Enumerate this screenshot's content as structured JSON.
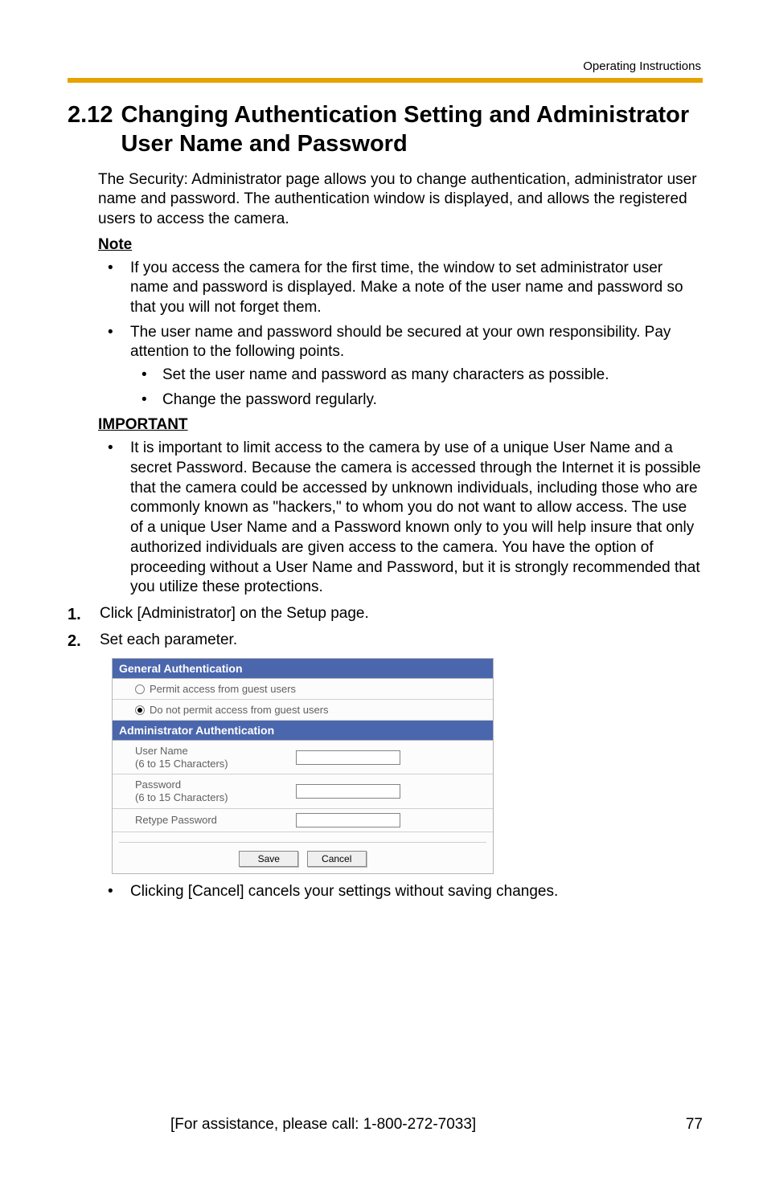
{
  "header": {
    "label": "Operating Instructions"
  },
  "section": {
    "number": "2.12",
    "title": "Changing Authentication Setting and Administrator User Name and Password"
  },
  "intro": "The Security: Administrator page allows you to change authentication, administrator user name and password. The authentication window is displayed, and allows the registered users to access the camera.",
  "note": {
    "heading": "Note",
    "items": [
      "If you access the camera for the first time, the window to set administrator user name and password is displayed. Make a note of the user name and password so that you will not forget them.",
      "The user name and password should be secured at your own responsibility. Pay attention to the following points."
    ],
    "subitems": [
      "Set the user name and password as many characters as possible.",
      "Change the password regularly."
    ]
  },
  "important": {
    "heading": "IMPORTANT",
    "items": [
      "It is important to limit access to the camera by use of a unique User Name and a secret Password. Because the camera is accessed through the Internet it is possible that the camera could be accessed by unknown individuals, including those who are commonly known as \"hackers,\" to whom you do not want to allow access. The use of a unique User Name and a Password known only to you will help insure that only authorized individuals are given access to the camera. You have the option of proceeding without a User Name and Password, but it is strongly recommended that you utilize these protections."
    ]
  },
  "steps": [
    "Click [Administrator] on the Setup page.",
    "Set each parameter."
  ],
  "form": {
    "general_header": "General Authentication",
    "radio_permit": "Permit access from guest users",
    "radio_deny": "Do not permit access from guest users",
    "admin_header": "Administrator Authentication",
    "username_label": "User Name\n(6 to 15 Characters)",
    "password_label": "Password\n(6 to 15 Characters)",
    "retype_label": "Retype Password",
    "save_btn": "Save",
    "cancel_btn": "Cancel"
  },
  "after_form_bullet": "Clicking [Cancel] cancels your settings without saving changes.",
  "footer": {
    "assist": "[For assistance, please call: 1-800-272-7033]",
    "page": "77"
  }
}
